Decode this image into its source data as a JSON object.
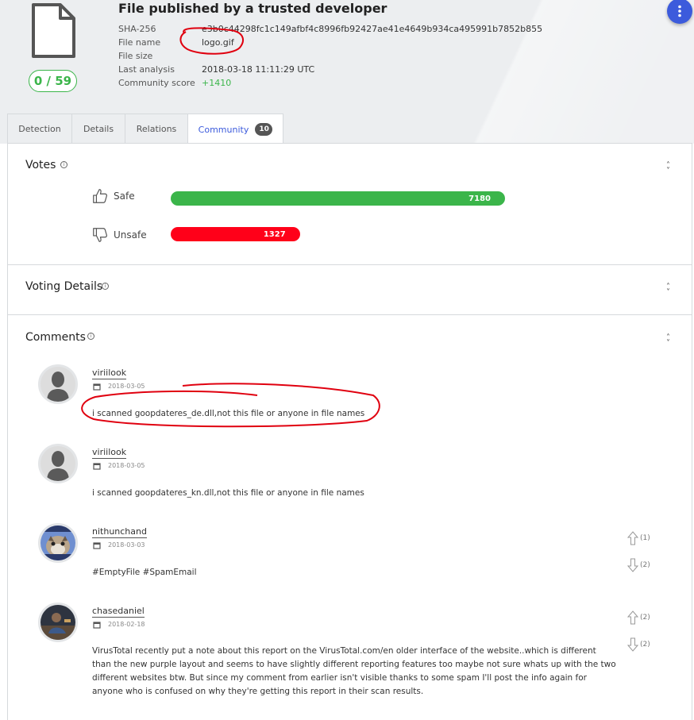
{
  "header": {
    "title": "File published by a trusted developer",
    "score": "0 / 59",
    "meta": [
      {
        "label": "SHA-256",
        "value": "e3b0c44298fc1c149afbf4c8996fb92427ae41e4649b934ca495991b7852b855"
      },
      {
        "label": "File name",
        "value": "logo.gif"
      },
      {
        "label": "File size",
        "value": ""
      },
      {
        "label": "Last analysis",
        "value": "2018-03-18 11:11:29 UTC"
      },
      {
        "label": "Community score",
        "value": "+1410"
      }
    ],
    "menu_icon": "vertical-dots-icon"
  },
  "tabs": [
    {
      "label": "Detection"
    },
    {
      "label": "Details"
    },
    {
      "label": "Relations"
    },
    {
      "label": "Community",
      "badge": "10",
      "active": true
    }
  ],
  "votes": {
    "title": "Votes",
    "safe": {
      "label": "Safe",
      "count": "7180",
      "value": 7180,
      "color": "#3bb54a"
    },
    "unsafe": {
      "label": "Unsafe",
      "count": "1327",
      "value": 1327,
      "color": "#ff0019"
    }
  },
  "voting_details": {
    "title": "Voting Details"
  },
  "comments": {
    "title": "Comments",
    "items": [
      {
        "author": "viriilook",
        "date": "2018-03-05",
        "text": "i scanned goopdateres_de.dll,not this file or anyone in file names"
      },
      {
        "author": "viriilook",
        "date": "2018-03-05",
        "text": "i scanned goopdateres_kn.dll,not this file or anyone in file names"
      },
      {
        "author": "nithunchand",
        "date": "2018-03-03",
        "text": "#EmptyFile #SpamEmail",
        "up": "(1)",
        "down": "(2)"
      },
      {
        "author": "chasedaniel",
        "date": "2018-02-18",
        "text": "VirusTotal recently put a note about this report on the VirusTotal.com/en older interface of the website..which is different than the new purple layout and seems to have slightly different reporting features too maybe not sure whats up with the two different websites btw. But since my comment from earlier isn't visible thanks to some spam I'll post the info again for anyone who is confused on why they're getting this report in their scan results.",
        "up": "(2)",
        "down": "(2)"
      }
    ]
  },
  "colors": {
    "accent": "#3c5bdc",
    "safe": "#3bb54a",
    "unsafe": "#ff0019",
    "annotation": "#e0000f"
  }
}
